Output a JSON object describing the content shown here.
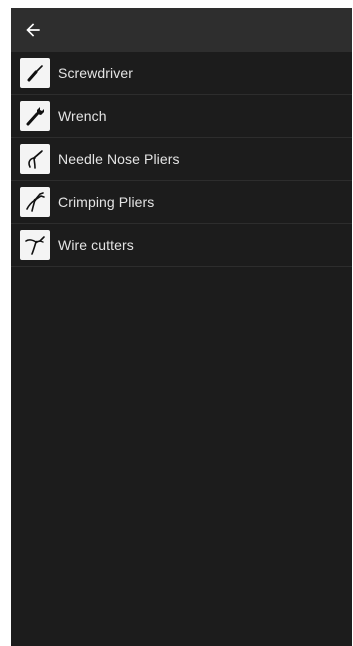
{
  "toolbar": {
    "back_icon": "arrow-left-icon"
  },
  "tools": [
    {
      "label": "Screwdriver",
      "icon": "screwdriver-icon"
    },
    {
      "label": "Wrench",
      "icon": "wrench-icon"
    },
    {
      "label": "Needle Nose Pliers",
      "icon": "needle-nose-pliers-icon"
    },
    {
      "label": "Crimping Pliers",
      "icon": "crimping-pliers-icon"
    },
    {
      "label": "Wire cutters",
      "icon": "wire-cutters-icon"
    }
  ],
  "colors": {
    "background": "#1c1c1c",
    "toolbar": "#2e2e2e",
    "text": "#e4e4e4",
    "icon_tile": "#f4f4f4"
  }
}
